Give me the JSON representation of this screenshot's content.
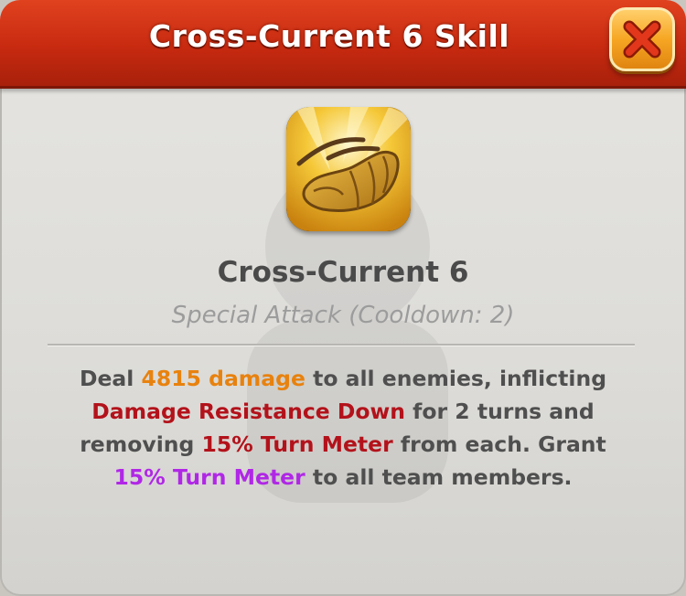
{
  "header": {
    "title": "Cross-Current 6 Skill"
  },
  "skill": {
    "icon": "lunge-attack-icon",
    "name": "Cross-Current 6",
    "type": "Special Attack (Cooldown: 2)"
  },
  "description": {
    "p1": "Deal ",
    "damage": "4815 damage",
    "p2": " to all enemies, inflicting ",
    "debuff": "Damage Resistance Down",
    "p3": " for 2 turns and removing ",
    "tm_remove": "15% Turn Meter",
    "p4": " from each. Grant ",
    "tm_grant": "15% Turn Meter",
    "p5": " to all team members."
  },
  "colors": {
    "header": "#c72a10",
    "damage": "#e8820e",
    "debuff": "#b3121b",
    "buff": "#b027e6"
  }
}
